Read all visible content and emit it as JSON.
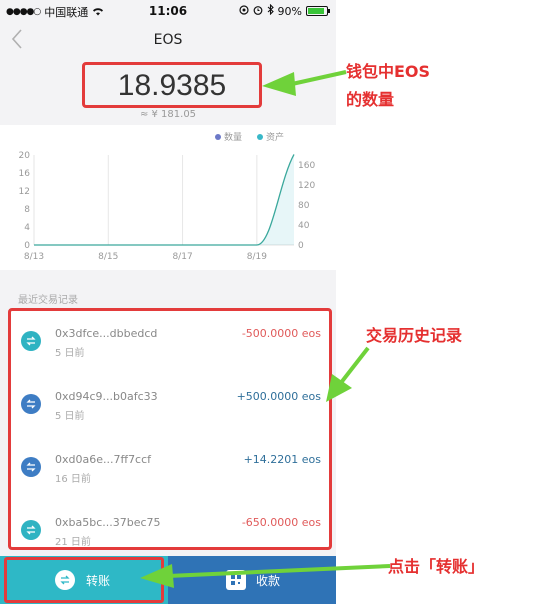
{
  "status_bar": {
    "carrier": "中国联通",
    "time": "11:06",
    "battery": "90%"
  },
  "nav": {
    "title": "EOS"
  },
  "balance": {
    "value": "18.9385",
    "fiat": "≈ ¥ 181.05"
  },
  "chart_data": {
    "type": "line",
    "legend": [
      {
        "name": "数量",
        "color": "#6c79c8"
      },
      {
        "name": "资产",
        "color": "#39b8c8"
      }
    ],
    "x_ticks": [
      "8/13",
      "8/15",
      "8/17",
      "8/19"
    ],
    "x": [
      "8/13",
      "8/14",
      "8/15",
      "8/16",
      "8/17",
      "8/18",
      "8/19",
      "8/20"
    ],
    "left_axis": {
      "ticks": [
        0,
        4,
        8,
        12,
        16,
        20
      ],
      "ylim": [
        0,
        20
      ]
    },
    "right_axis": {
      "ticks": [
        0,
        40,
        80,
        120,
        160
      ],
      "ylim": [
        0,
        180
      ]
    },
    "series": [
      {
        "name": "资产",
        "axis": "right",
        "values": [
          0,
          0,
          0,
          0,
          0,
          0,
          0,
          181.05
        ]
      }
    ],
    "grid": "vertical"
  },
  "history": {
    "title": "最近交易记录",
    "items": [
      {
        "address": "0x3dfce...dbbedcd",
        "time": "5 日前",
        "amount": "-500.0000 eos",
        "direction": "out"
      },
      {
        "address": "0xd94c9...b0afc33",
        "time": "5 日前",
        "amount": "+500.0000 eos",
        "direction": "in"
      },
      {
        "address": "0xd0a6e...7ff7ccf",
        "time": "16 日前",
        "amount": "+14.2201 eos",
        "direction": "in"
      },
      {
        "address": "0xba5bc...37bec75",
        "time": "21 日前",
        "amount": "-650.0000 eos",
        "direction": "out"
      }
    ]
  },
  "actions": {
    "transfer": "转账",
    "receive": "收款"
  },
  "annotations": {
    "balance_line1": "钱包中EOS",
    "balance_line2": "的数量",
    "history": "交易历史记录",
    "transfer": "点击「转账」"
  },
  "colors": {
    "annotation_red": "#e33b3b",
    "arrow_green": "#6fd23a",
    "transfer_bg": "#2eb8c6",
    "receive_bg": "#2f73b6",
    "out_icon": "#2fb3c2",
    "in_icon": "#3e7dc4"
  }
}
